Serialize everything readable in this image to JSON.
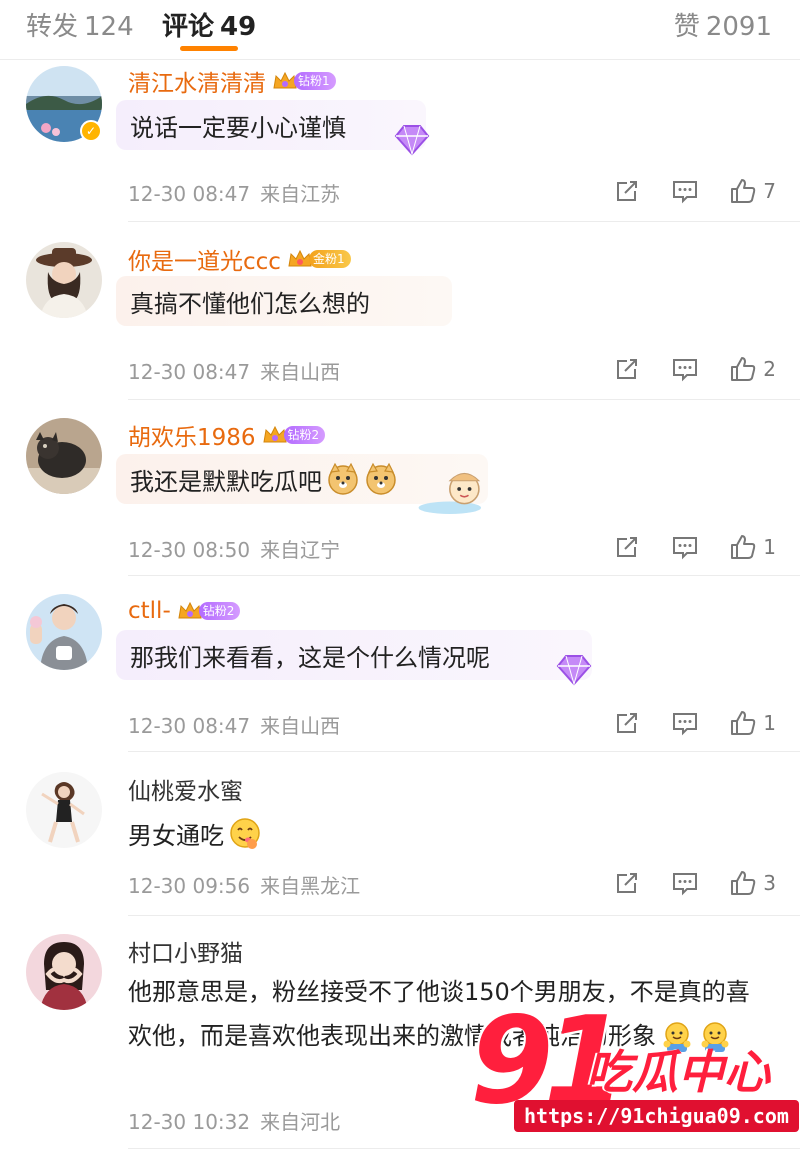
{
  "tabs": {
    "repost": {
      "label": "转发",
      "count": "124"
    },
    "comment": {
      "label": "评论",
      "count": "49"
    },
    "like": {
      "label": "赞",
      "count": "2091"
    }
  },
  "accent_color": "#ff8200",
  "username_color": "#e86a0f",
  "comments": [
    {
      "username": "清江水清清清",
      "fan_badge": "钻粉1",
      "text": "说话一定要小心谨慎",
      "date": "12-30 08:47",
      "source": "来自江苏",
      "likes": "7"
    },
    {
      "username": "你是一道光ccc",
      "fan_badge": "金粉1",
      "text": "真搞不懂他们怎么想的",
      "date": "12-30 08:47",
      "source": "来自山西",
      "likes": "2"
    },
    {
      "username": "胡欢乐1986",
      "fan_badge": "钻粉2",
      "text": "我还是默默吃瓜吧",
      "date": "12-30 08:50",
      "source": "来自辽宁",
      "likes": "1"
    },
    {
      "username": "ctll-",
      "fan_badge": "钻粉2",
      "text": "那我们来看看，这是个什么情况呢",
      "date": "12-30 08:47",
      "source": "来自山西",
      "likes": "1"
    },
    {
      "username": "仙桃爱水蜜",
      "fan_badge": "",
      "text": "男女通吃",
      "date": "12-30 09:56",
      "source": "来自黑龙江",
      "likes": "3"
    },
    {
      "username": "村口小野猫",
      "fan_badge": "",
      "text": "他那意思是，粉丝接受不了他谈150个男朋友，不是真的喜欢他，而是喜欢他表现出来的激情或者纯洁的形象",
      "date": "12-30 10:32",
      "source": "来自河北",
      "likes": ""
    }
  ],
  "icons": {
    "share": "share-icon",
    "comment": "comment-icon",
    "like": "thumbs-up-icon",
    "verified": "verified-badge-icon",
    "gem": "diamond-gem-icon"
  },
  "watermark": {
    "number": "91",
    "brand": "吃瓜中心",
    "url": "https://91chigua09.com",
    "color": "#ff1f3d"
  }
}
